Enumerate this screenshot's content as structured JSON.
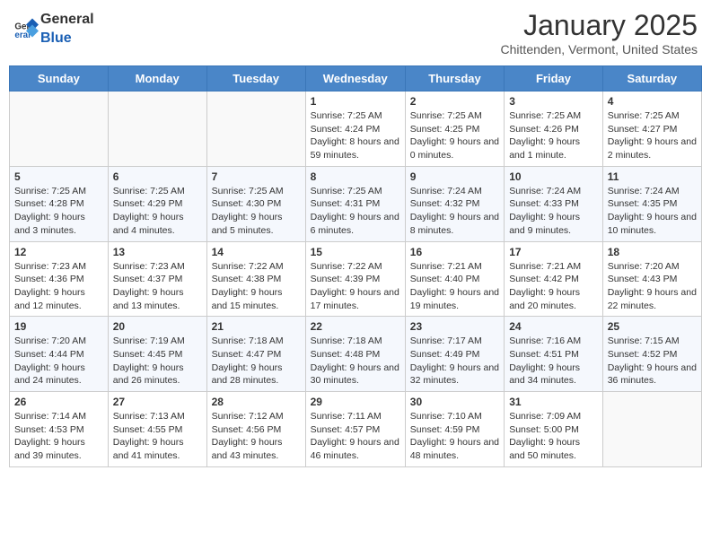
{
  "header": {
    "logo_general": "General",
    "logo_blue": "Blue",
    "month": "January 2025",
    "location": "Chittenden, Vermont, United States"
  },
  "weekdays": [
    "Sunday",
    "Monday",
    "Tuesday",
    "Wednesday",
    "Thursday",
    "Friday",
    "Saturday"
  ],
  "weeks": [
    [
      {
        "day": "",
        "info": ""
      },
      {
        "day": "",
        "info": ""
      },
      {
        "day": "",
        "info": ""
      },
      {
        "day": "1",
        "info": "Sunrise: 7:25 AM\nSunset: 4:24 PM\nDaylight: 8 hours and 59 minutes."
      },
      {
        "day": "2",
        "info": "Sunrise: 7:25 AM\nSunset: 4:25 PM\nDaylight: 9 hours and 0 minutes."
      },
      {
        "day": "3",
        "info": "Sunrise: 7:25 AM\nSunset: 4:26 PM\nDaylight: 9 hours and 1 minute."
      },
      {
        "day": "4",
        "info": "Sunrise: 7:25 AM\nSunset: 4:27 PM\nDaylight: 9 hours and 2 minutes."
      }
    ],
    [
      {
        "day": "5",
        "info": "Sunrise: 7:25 AM\nSunset: 4:28 PM\nDaylight: 9 hours and 3 minutes."
      },
      {
        "day": "6",
        "info": "Sunrise: 7:25 AM\nSunset: 4:29 PM\nDaylight: 9 hours and 4 minutes."
      },
      {
        "day": "7",
        "info": "Sunrise: 7:25 AM\nSunset: 4:30 PM\nDaylight: 9 hours and 5 minutes."
      },
      {
        "day": "8",
        "info": "Sunrise: 7:25 AM\nSunset: 4:31 PM\nDaylight: 9 hours and 6 minutes."
      },
      {
        "day": "9",
        "info": "Sunrise: 7:24 AM\nSunset: 4:32 PM\nDaylight: 9 hours and 8 minutes."
      },
      {
        "day": "10",
        "info": "Sunrise: 7:24 AM\nSunset: 4:33 PM\nDaylight: 9 hours and 9 minutes."
      },
      {
        "day": "11",
        "info": "Sunrise: 7:24 AM\nSunset: 4:35 PM\nDaylight: 9 hours and 10 minutes."
      }
    ],
    [
      {
        "day": "12",
        "info": "Sunrise: 7:23 AM\nSunset: 4:36 PM\nDaylight: 9 hours and 12 minutes."
      },
      {
        "day": "13",
        "info": "Sunrise: 7:23 AM\nSunset: 4:37 PM\nDaylight: 9 hours and 13 minutes."
      },
      {
        "day": "14",
        "info": "Sunrise: 7:22 AM\nSunset: 4:38 PM\nDaylight: 9 hours and 15 minutes."
      },
      {
        "day": "15",
        "info": "Sunrise: 7:22 AM\nSunset: 4:39 PM\nDaylight: 9 hours and 17 minutes."
      },
      {
        "day": "16",
        "info": "Sunrise: 7:21 AM\nSunset: 4:40 PM\nDaylight: 9 hours and 19 minutes."
      },
      {
        "day": "17",
        "info": "Sunrise: 7:21 AM\nSunset: 4:42 PM\nDaylight: 9 hours and 20 minutes."
      },
      {
        "day": "18",
        "info": "Sunrise: 7:20 AM\nSunset: 4:43 PM\nDaylight: 9 hours and 22 minutes."
      }
    ],
    [
      {
        "day": "19",
        "info": "Sunrise: 7:20 AM\nSunset: 4:44 PM\nDaylight: 9 hours and 24 minutes."
      },
      {
        "day": "20",
        "info": "Sunrise: 7:19 AM\nSunset: 4:45 PM\nDaylight: 9 hours and 26 minutes."
      },
      {
        "day": "21",
        "info": "Sunrise: 7:18 AM\nSunset: 4:47 PM\nDaylight: 9 hours and 28 minutes."
      },
      {
        "day": "22",
        "info": "Sunrise: 7:18 AM\nSunset: 4:48 PM\nDaylight: 9 hours and 30 minutes."
      },
      {
        "day": "23",
        "info": "Sunrise: 7:17 AM\nSunset: 4:49 PM\nDaylight: 9 hours and 32 minutes."
      },
      {
        "day": "24",
        "info": "Sunrise: 7:16 AM\nSunset: 4:51 PM\nDaylight: 9 hours and 34 minutes."
      },
      {
        "day": "25",
        "info": "Sunrise: 7:15 AM\nSunset: 4:52 PM\nDaylight: 9 hours and 36 minutes."
      }
    ],
    [
      {
        "day": "26",
        "info": "Sunrise: 7:14 AM\nSunset: 4:53 PM\nDaylight: 9 hours and 39 minutes."
      },
      {
        "day": "27",
        "info": "Sunrise: 7:13 AM\nSunset: 4:55 PM\nDaylight: 9 hours and 41 minutes."
      },
      {
        "day": "28",
        "info": "Sunrise: 7:12 AM\nSunset: 4:56 PM\nDaylight: 9 hours and 43 minutes."
      },
      {
        "day": "29",
        "info": "Sunrise: 7:11 AM\nSunset: 4:57 PM\nDaylight: 9 hours and 46 minutes."
      },
      {
        "day": "30",
        "info": "Sunrise: 7:10 AM\nSunset: 4:59 PM\nDaylight: 9 hours and 48 minutes."
      },
      {
        "day": "31",
        "info": "Sunrise: 7:09 AM\nSunset: 5:00 PM\nDaylight: 9 hours and 50 minutes."
      },
      {
        "day": "",
        "info": ""
      }
    ]
  ]
}
